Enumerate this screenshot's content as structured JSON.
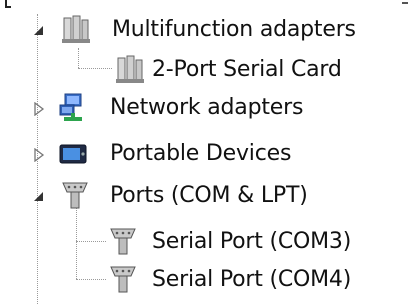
{
  "tree": {
    "items": [
      {
        "label": "Multifunction adapters",
        "icon": "multifunction-adapter-icon",
        "expanded": true
      },
      {
        "label": "2-Port Serial Card",
        "icon": "multifunction-adapter-icon"
      },
      {
        "label": "Network adapters",
        "icon": "network-adapter-icon",
        "expanded": false
      },
      {
        "label": "Portable Devices",
        "icon": "portable-device-icon",
        "expanded": false
      },
      {
        "label": "Ports (COM & LPT)",
        "icon": "port-icon",
        "expanded": true
      },
      {
        "label": "Serial Port (COM3)",
        "icon": "port-icon"
      },
      {
        "label": "Serial Port (COM4)",
        "icon": "port-icon"
      }
    ]
  }
}
